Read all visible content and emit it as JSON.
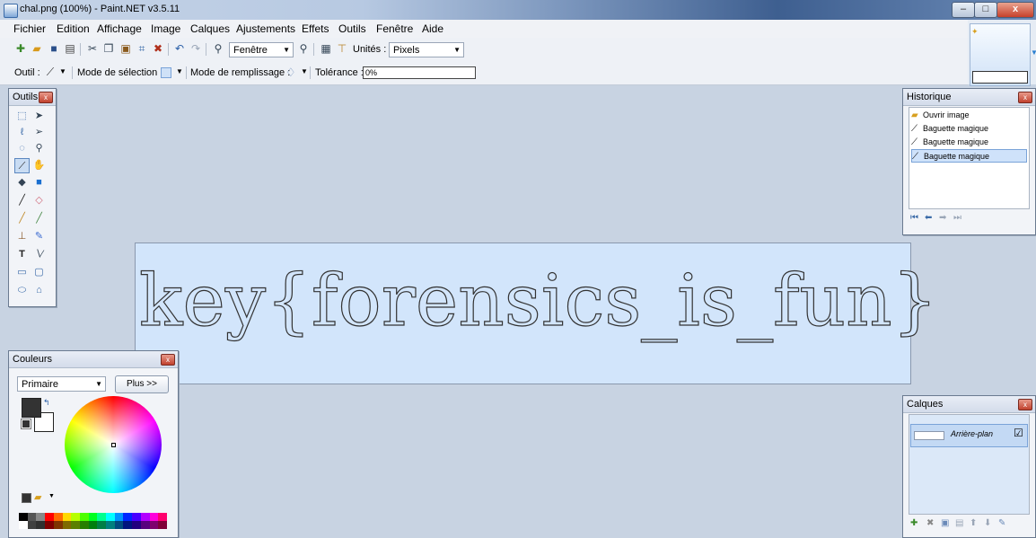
{
  "window": {
    "title": "chal.png (100%) - Paint.NET v3.5.11",
    "controls": [
      "–",
      "□",
      "x"
    ]
  },
  "menu": [
    "Fichier",
    "Edition",
    "Affichage",
    "Image",
    "Calques",
    "Ajustements",
    "Effets",
    "Outils",
    "Fenêtre",
    "Aide"
  ],
  "toolbar": {
    "zoom_combo": "Fenêtre",
    "units_label": "Unités :",
    "units_value": "Pixels",
    "tool_label": "Outil :",
    "selection_mode_label": "Mode de sélection :",
    "fill_mode_label": "Mode de remplissage :",
    "tolerance_label": "Tolérance :",
    "tolerance_value": "0%"
  },
  "tools_panel": {
    "title": "Outils"
  },
  "history_panel": {
    "title": "Historique",
    "items": [
      "Ouvrir image",
      "Baguette magique",
      "Baguette magique",
      "Baguette magique"
    ],
    "selected_index": 3
  },
  "colors_panel": {
    "title": "Couleurs",
    "mode": "Primaire",
    "more_button": "Plus >>",
    "primary_color": "#333333",
    "secondary_color": "#ffffff",
    "palette_top": [
      "#000000",
      "#555555",
      "#888888",
      "#ff0000",
      "#ff6a00",
      "#ffd800",
      "#b6ff00",
      "#4cff00",
      "#00ff21",
      "#00ff90",
      "#00ffff",
      "#0094ff",
      "#0026ff",
      "#4800ff",
      "#b200ff",
      "#ff00dc",
      "#ff006e"
    ],
    "palette_bottom": [
      "#ffffff",
      "#404040",
      "#303030",
      "#7f0000",
      "#7f3300",
      "#7f6a00",
      "#5b7f00",
      "#267f00",
      "#007f0e",
      "#007f46",
      "#007f7f",
      "#004a7f",
      "#00137f",
      "#21007f",
      "#57007f",
      "#7f006e",
      "#7f0037"
    ]
  },
  "layers_panel": {
    "title": "Calques",
    "layer_name": "Arrière-plan",
    "visible_check": "☑"
  },
  "canvas": {
    "text": "key{forensics_is_fun}"
  }
}
